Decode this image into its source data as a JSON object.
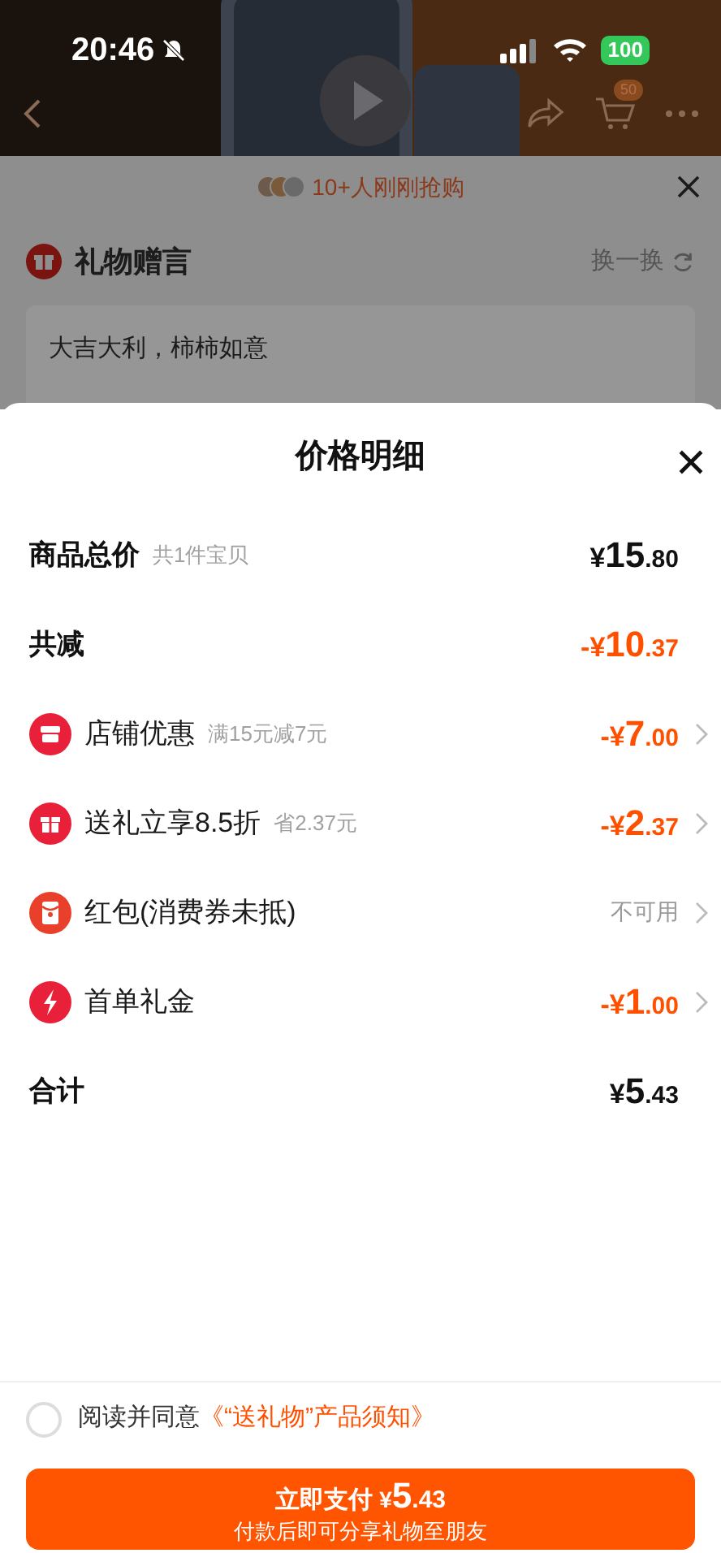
{
  "status_bar": {
    "time": "20:46",
    "battery": "100"
  },
  "nav": {
    "cart_badge": "50"
  },
  "gift_sheet": {
    "buyers_text": "10+人刚刚抢购",
    "section_title": "礼物赠言",
    "shuffle_label": "换一换",
    "message": "大吉大利，柿柿如意"
  },
  "price_sheet": {
    "title": "价格明细",
    "rows": [
      {
        "kind": "plain",
        "label": "商品总价",
        "note": "共1件宝贝",
        "value": "¥15.80"
      },
      {
        "kind": "saving",
        "label": "共减",
        "value": "-¥10.37"
      },
      {
        "kind": "discount",
        "label": "店铺优惠",
        "note": "满15元减7元",
        "value": "-¥7.00"
      },
      {
        "kind": "discount",
        "label": "送礼立享8.5折",
        "note": "省2.37元",
        "value": "-¥2.37"
      },
      {
        "kind": "unavailable",
        "label": "红包(消费券未抵)",
        "value": "不可用"
      },
      {
        "kind": "discount",
        "label": "首单礼金",
        "value": "-¥1.00"
      },
      {
        "kind": "plain",
        "label": "合计",
        "value": "¥5.43"
      }
    ],
    "agreement": {
      "checked": false,
      "text": "阅读并同意",
      "link": "《“送礼物”产品须知》"
    },
    "pay_button": {
      "label": "立即支付",
      "amount": "¥5.43",
      "subtitle": "付款后即可分享礼物至朋友"
    }
  }
}
